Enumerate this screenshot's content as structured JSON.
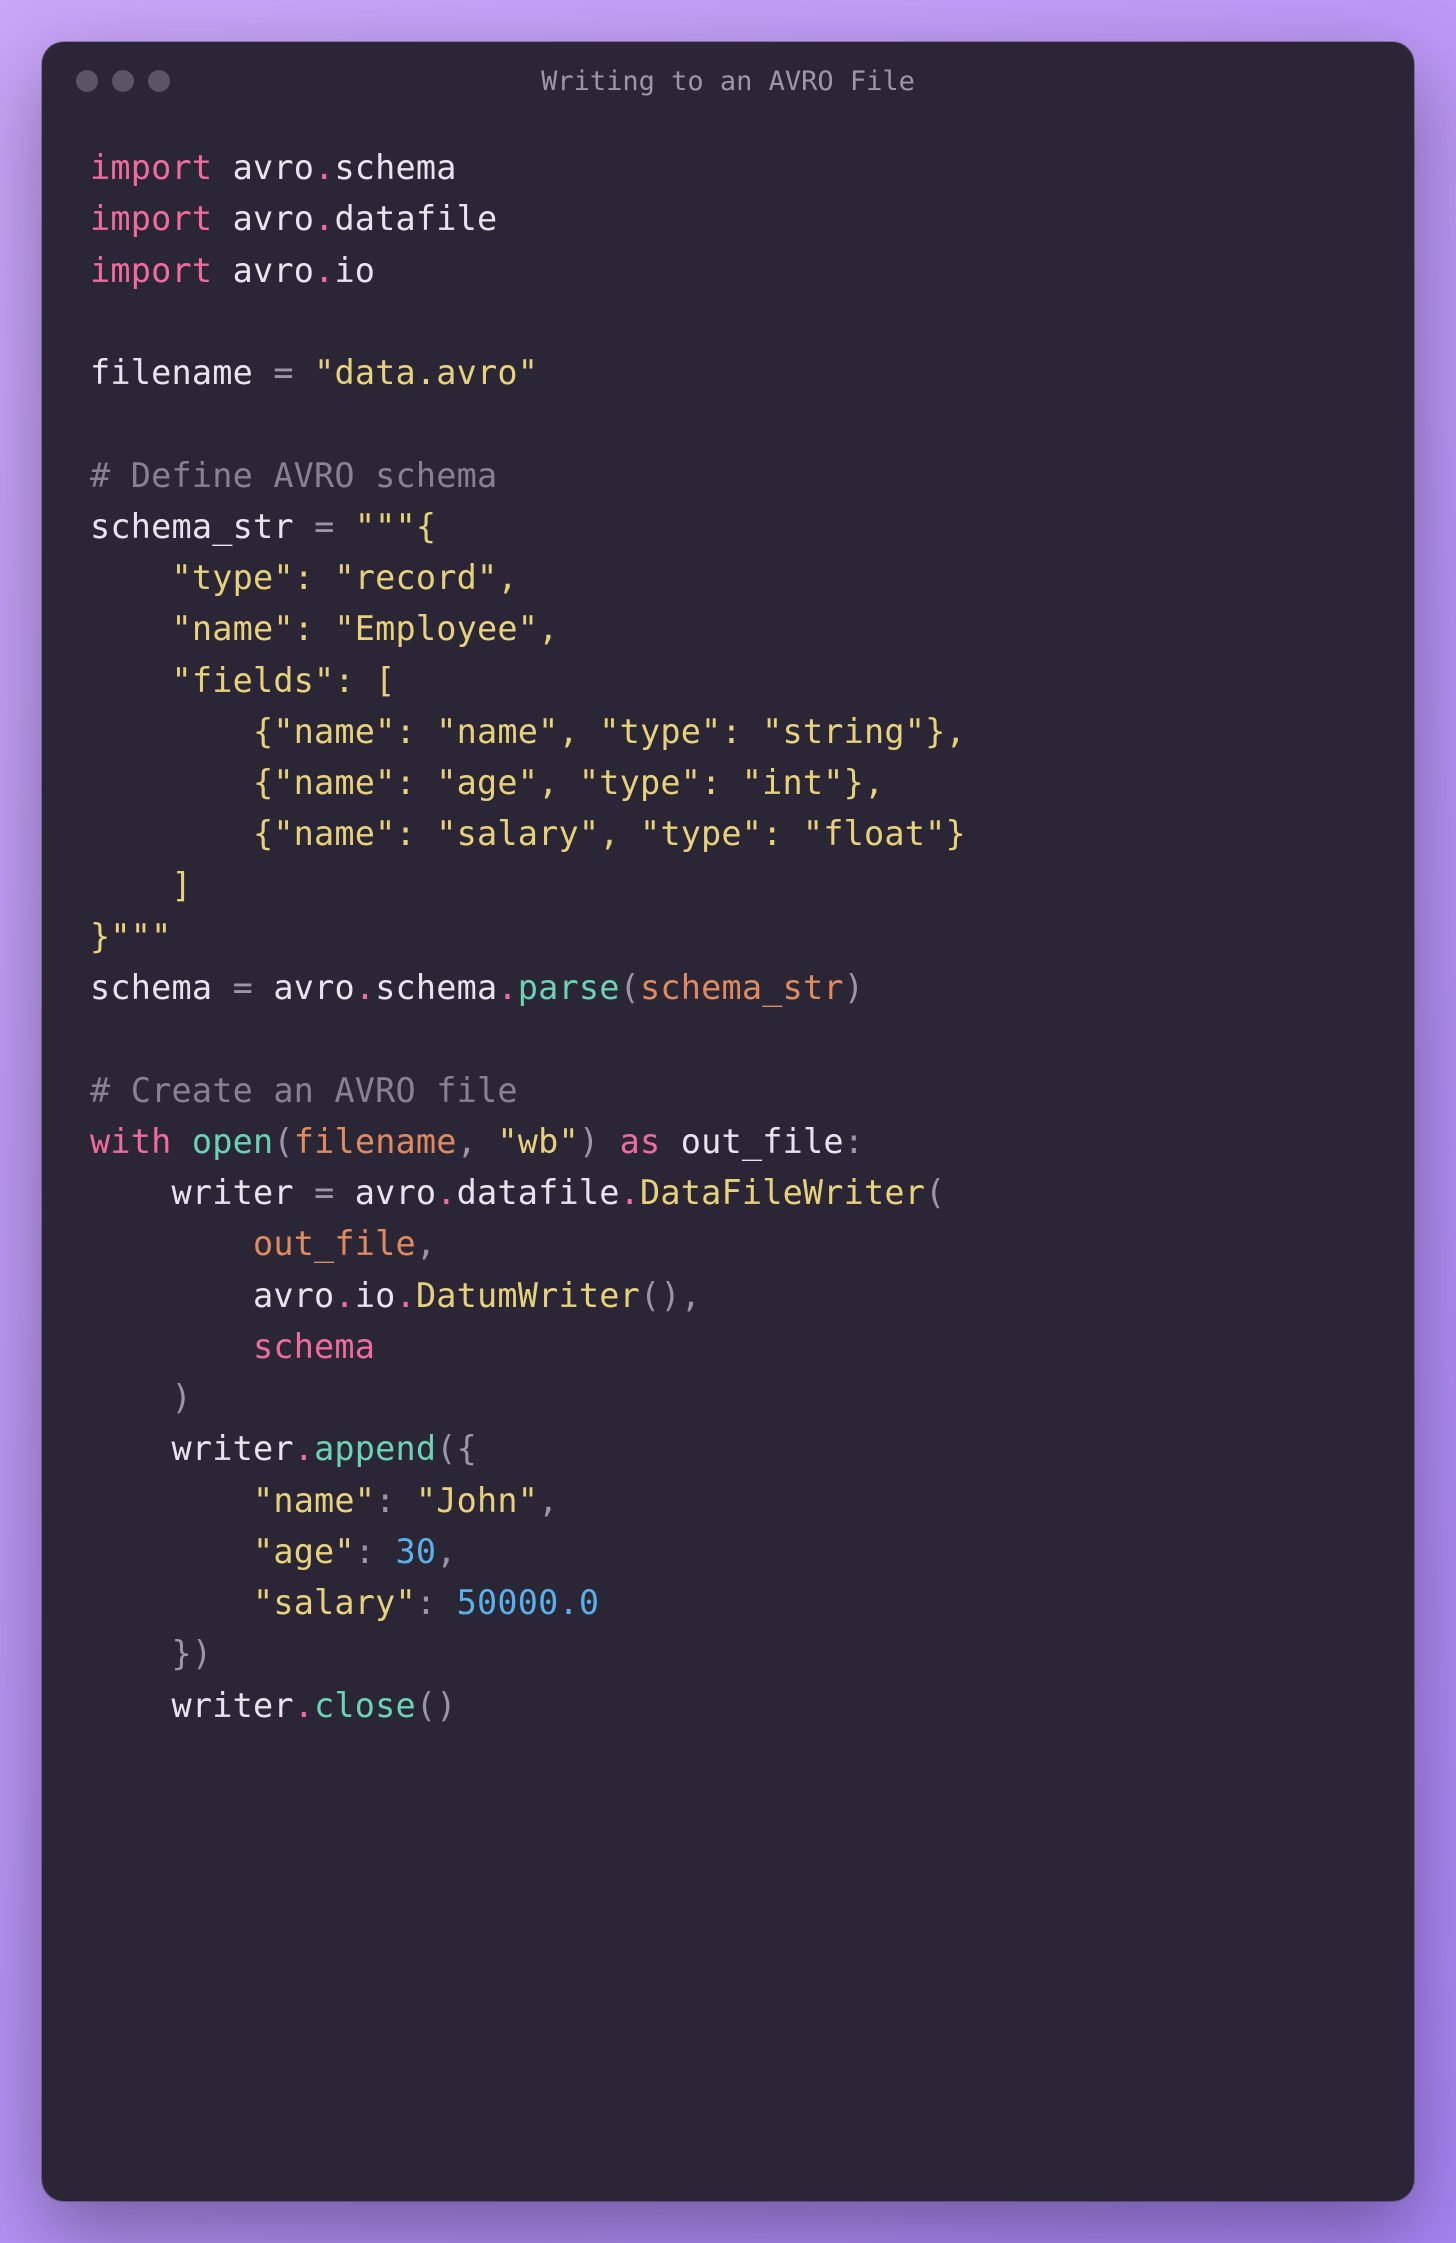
{
  "window": {
    "title": "Writing to an AVRO File"
  },
  "colors": {
    "background_gradient_start": "#c9a6f8",
    "background_gradient_end": "#a784f2",
    "window_bg": "#2b2636",
    "dot": "#5a5564",
    "title_text": "#9c97a6",
    "code_default": "#e8e4ef",
    "keyword": "#f06b9e",
    "string": "#e7d27b",
    "comment": "#878192",
    "function": "#6bd3b3",
    "parameter": "#e08a5f",
    "number": "#5ab0ea",
    "punct": "#9b95a8"
  },
  "code": {
    "tokens": [
      [
        {
          "t": "keyword",
          "v": "import"
        },
        {
          "t": "ident",
          "v": " avro"
        },
        {
          "t": "punct-dot",
          "v": "."
        },
        {
          "t": "ident",
          "v": "schema"
        }
      ],
      [
        {
          "t": "keyword",
          "v": "import"
        },
        {
          "t": "ident",
          "v": " avro"
        },
        {
          "t": "punct-dot",
          "v": "."
        },
        {
          "t": "ident",
          "v": "datafile"
        }
      ],
      [
        {
          "t": "keyword",
          "v": "import"
        },
        {
          "t": "ident",
          "v": " avro"
        },
        {
          "t": "punct-dot",
          "v": "."
        },
        {
          "t": "ident",
          "v": "io"
        }
      ],
      [],
      [
        {
          "t": "ident",
          "v": "filename "
        },
        {
          "t": "punct",
          "v": "="
        },
        {
          "t": "ident",
          "v": " "
        },
        {
          "t": "string",
          "v": "\"data.avro\""
        }
      ],
      [],
      [
        {
          "t": "comment",
          "v": "# Define AVRO schema"
        }
      ],
      [
        {
          "t": "ident",
          "v": "schema_str "
        },
        {
          "t": "punct",
          "v": "="
        },
        {
          "t": "ident",
          "v": " "
        },
        {
          "t": "string",
          "v": "\"\"\"{"
        }
      ],
      [
        {
          "t": "string",
          "v": "    \"type\": \"record\","
        }
      ],
      [
        {
          "t": "string",
          "v": "    \"name\": \"Employee\","
        }
      ],
      [
        {
          "t": "string",
          "v": "    \"fields\": ["
        }
      ],
      [
        {
          "t": "string",
          "v": "        {\"name\": \"name\", \"type\": \"string\"},"
        }
      ],
      [
        {
          "t": "string",
          "v": "        {\"name\": \"age\", \"type\": \"int\"},"
        }
      ],
      [
        {
          "t": "string",
          "v": "        {\"name\": \"salary\", \"type\": \"float\"}"
        }
      ],
      [
        {
          "t": "string",
          "v": "    ]"
        }
      ],
      [
        {
          "t": "string",
          "v": "}\"\"\""
        }
      ],
      [
        {
          "t": "ident",
          "v": "schema "
        },
        {
          "t": "punct",
          "v": "="
        },
        {
          "t": "ident",
          "v": " avro"
        },
        {
          "t": "punct-dot",
          "v": "."
        },
        {
          "t": "ident",
          "v": "schema"
        },
        {
          "t": "punct-dot",
          "v": "."
        },
        {
          "t": "func",
          "v": "parse"
        },
        {
          "t": "punct",
          "v": "("
        },
        {
          "t": "param",
          "v": "schema_str"
        },
        {
          "t": "punct",
          "v": ")"
        }
      ],
      [],
      [
        {
          "t": "comment",
          "v": "# Create an AVRO file"
        }
      ],
      [
        {
          "t": "keyword",
          "v": "with"
        },
        {
          "t": "ident",
          "v": " "
        },
        {
          "t": "func",
          "v": "open"
        },
        {
          "t": "punct",
          "v": "("
        },
        {
          "t": "param",
          "v": "filename"
        },
        {
          "t": "punct",
          "v": ", "
        },
        {
          "t": "string",
          "v": "\"wb\""
        },
        {
          "t": "punct",
          "v": ")"
        },
        {
          "t": "ident",
          "v": " "
        },
        {
          "t": "keyword",
          "v": "as"
        },
        {
          "t": "ident",
          "v": " out_file"
        },
        {
          "t": "punct",
          "v": ":"
        }
      ],
      [
        {
          "t": "ident",
          "v": "    writer "
        },
        {
          "t": "punct",
          "v": "="
        },
        {
          "t": "ident",
          "v": " avro"
        },
        {
          "t": "punct-dot",
          "v": "."
        },
        {
          "t": "ident",
          "v": "datafile"
        },
        {
          "t": "punct-dot",
          "v": "."
        },
        {
          "t": "cls",
          "v": "DataFileWriter"
        },
        {
          "t": "punct",
          "v": "("
        }
      ],
      [
        {
          "t": "ident",
          "v": "        "
        },
        {
          "t": "param",
          "v": "out_file"
        },
        {
          "t": "punct",
          "v": ","
        }
      ],
      [
        {
          "t": "ident",
          "v": "        avro"
        },
        {
          "t": "punct-dot",
          "v": "."
        },
        {
          "t": "ident",
          "v": "io"
        },
        {
          "t": "punct-dot",
          "v": "."
        },
        {
          "t": "cls",
          "v": "DatumWriter"
        },
        {
          "t": "punct",
          "v": "(),"
        }
      ],
      [
        {
          "t": "ident",
          "v": "        "
        },
        {
          "t": "keyword",
          "v": "schema"
        }
      ],
      [
        {
          "t": "ident",
          "v": "    "
        },
        {
          "t": "punct",
          "v": ")"
        }
      ],
      [
        {
          "t": "ident",
          "v": "    writer"
        },
        {
          "t": "punct-dot",
          "v": "."
        },
        {
          "t": "func",
          "v": "append"
        },
        {
          "t": "punct",
          "v": "({"
        }
      ],
      [
        {
          "t": "ident",
          "v": "        "
        },
        {
          "t": "string",
          "v": "\"name\""
        },
        {
          "t": "punct",
          "v": ": "
        },
        {
          "t": "string",
          "v": "\"John\""
        },
        {
          "t": "punct",
          "v": ","
        }
      ],
      [
        {
          "t": "ident",
          "v": "        "
        },
        {
          "t": "string",
          "v": "\"age\""
        },
        {
          "t": "punct",
          "v": ": "
        },
        {
          "t": "number",
          "v": "30"
        },
        {
          "t": "punct",
          "v": ","
        }
      ],
      [
        {
          "t": "ident",
          "v": "        "
        },
        {
          "t": "string",
          "v": "\"salary\""
        },
        {
          "t": "punct",
          "v": ": "
        },
        {
          "t": "number",
          "v": "50000.0"
        }
      ],
      [
        {
          "t": "ident",
          "v": "    "
        },
        {
          "t": "punct",
          "v": "})"
        }
      ],
      [
        {
          "t": "ident",
          "v": "    writer"
        },
        {
          "t": "punct-dot",
          "v": "."
        },
        {
          "t": "func",
          "v": "close"
        },
        {
          "t": "punct",
          "v": "()"
        }
      ]
    ]
  }
}
